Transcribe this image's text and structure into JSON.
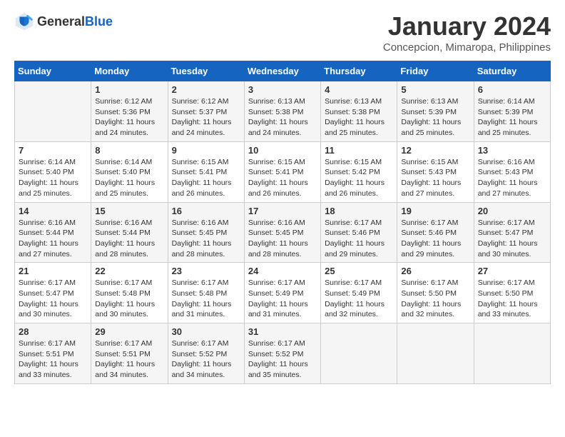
{
  "header": {
    "logo_general": "General",
    "logo_blue": "Blue",
    "month_title": "January 2024",
    "subtitle": "Concepcion, Mimaropa, Philippines"
  },
  "weekdays": [
    "Sunday",
    "Monday",
    "Tuesday",
    "Wednesday",
    "Thursday",
    "Friday",
    "Saturday"
  ],
  "weeks": [
    [
      {
        "day": "",
        "sunrise": "",
        "sunset": "",
        "daylight": ""
      },
      {
        "day": "1",
        "sunrise": "Sunrise: 6:12 AM",
        "sunset": "Sunset: 5:36 PM",
        "daylight": "Daylight: 11 hours and 24 minutes."
      },
      {
        "day": "2",
        "sunrise": "Sunrise: 6:12 AM",
        "sunset": "Sunset: 5:37 PM",
        "daylight": "Daylight: 11 hours and 24 minutes."
      },
      {
        "day": "3",
        "sunrise": "Sunrise: 6:13 AM",
        "sunset": "Sunset: 5:38 PM",
        "daylight": "Daylight: 11 hours and 24 minutes."
      },
      {
        "day": "4",
        "sunrise": "Sunrise: 6:13 AM",
        "sunset": "Sunset: 5:38 PM",
        "daylight": "Daylight: 11 hours and 25 minutes."
      },
      {
        "day": "5",
        "sunrise": "Sunrise: 6:13 AM",
        "sunset": "Sunset: 5:39 PM",
        "daylight": "Daylight: 11 hours and 25 minutes."
      },
      {
        "day": "6",
        "sunrise": "Sunrise: 6:14 AM",
        "sunset": "Sunset: 5:39 PM",
        "daylight": "Daylight: 11 hours and 25 minutes."
      }
    ],
    [
      {
        "day": "7",
        "sunrise": "Sunrise: 6:14 AM",
        "sunset": "Sunset: 5:40 PM",
        "daylight": "Daylight: 11 hours and 25 minutes."
      },
      {
        "day": "8",
        "sunrise": "Sunrise: 6:14 AM",
        "sunset": "Sunset: 5:40 PM",
        "daylight": "Daylight: 11 hours and 25 minutes."
      },
      {
        "day": "9",
        "sunrise": "Sunrise: 6:15 AM",
        "sunset": "Sunset: 5:41 PM",
        "daylight": "Daylight: 11 hours and 26 minutes."
      },
      {
        "day": "10",
        "sunrise": "Sunrise: 6:15 AM",
        "sunset": "Sunset: 5:41 PM",
        "daylight": "Daylight: 11 hours and 26 minutes."
      },
      {
        "day": "11",
        "sunrise": "Sunrise: 6:15 AM",
        "sunset": "Sunset: 5:42 PM",
        "daylight": "Daylight: 11 hours and 26 minutes."
      },
      {
        "day": "12",
        "sunrise": "Sunrise: 6:15 AM",
        "sunset": "Sunset: 5:43 PM",
        "daylight": "Daylight: 11 hours and 27 minutes."
      },
      {
        "day": "13",
        "sunrise": "Sunrise: 6:16 AM",
        "sunset": "Sunset: 5:43 PM",
        "daylight": "Daylight: 11 hours and 27 minutes."
      }
    ],
    [
      {
        "day": "14",
        "sunrise": "Sunrise: 6:16 AM",
        "sunset": "Sunset: 5:44 PM",
        "daylight": "Daylight: 11 hours and 27 minutes."
      },
      {
        "day": "15",
        "sunrise": "Sunrise: 6:16 AM",
        "sunset": "Sunset: 5:44 PM",
        "daylight": "Daylight: 11 hours and 28 minutes."
      },
      {
        "day": "16",
        "sunrise": "Sunrise: 6:16 AM",
        "sunset": "Sunset: 5:45 PM",
        "daylight": "Daylight: 11 hours and 28 minutes."
      },
      {
        "day": "17",
        "sunrise": "Sunrise: 6:16 AM",
        "sunset": "Sunset: 5:45 PM",
        "daylight": "Daylight: 11 hours and 28 minutes."
      },
      {
        "day": "18",
        "sunrise": "Sunrise: 6:17 AM",
        "sunset": "Sunset: 5:46 PM",
        "daylight": "Daylight: 11 hours and 29 minutes."
      },
      {
        "day": "19",
        "sunrise": "Sunrise: 6:17 AM",
        "sunset": "Sunset: 5:46 PM",
        "daylight": "Daylight: 11 hours and 29 minutes."
      },
      {
        "day": "20",
        "sunrise": "Sunrise: 6:17 AM",
        "sunset": "Sunset: 5:47 PM",
        "daylight": "Daylight: 11 hours and 30 minutes."
      }
    ],
    [
      {
        "day": "21",
        "sunrise": "Sunrise: 6:17 AM",
        "sunset": "Sunset: 5:47 PM",
        "daylight": "Daylight: 11 hours and 30 minutes."
      },
      {
        "day": "22",
        "sunrise": "Sunrise: 6:17 AM",
        "sunset": "Sunset: 5:48 PM",
        "daylight": "Daylight: 11 hours and 30 minutes."
      },
      {
        "day": "23",
        "sunrise": "Sunrise: 6:17 AM",
        "sunset": "Sunset: 5:48 PM",
        "daylight": "Daylight: 11 hours and 31 minutes."
      },
      {
        "day": "24",
        "sunrise": "Sunrise: 6:17 AM",
        "sunset": "Sunset: 5:49 PM",
        "daylight": "Daylight: 11 hours and 31 minutes."
      },
      {
        "day": "25",
        "sunrise": "Sunrise: 6:17 AM",
        "sunset": "Sunset: 5:49 PM",
        "daylight": "Daylight: 11 hours and 32 minutes."
      },
      {
        "day": "26",
        "sunrise": "Sunrise: 6:17 AM",
        "sunset": "Sunset: 5:50 PM",
        "daylight": "Daylight: 11 hours and 32 minutes."
      },
      {
        "day": "27",
        "sunrise": "Sunrise: 6:17 AM",
        "sunset": "Sunset: 5:50 PM",
        "daylight": "Daylight: 11 hours and 33 minutes."
      }
    ],
    [
      {
        "day": "28",
        "sunrise": "Sunrise: 6:17 AM",
        "sunset": "Sunset: 5:51 PM",
        "daylight": "Daylight: 11 hours and 33 minutes."
      },
      {
        "day": "29",
        "sunrise": "Sunrise: 6:17 AM",
        "sunset": "Sunset: 5:51 PM",
        "daylight": "Daylight: 11 hours and 34 minutes."
      },
      {
        "day": "30",
        "sunrise": "Sunrise: 6:17 AM",
        "sunset": "Sunset: 5:52 PM",
        "daylight": "Daylight: 11 hours and 34 minutes."
      },
      {
        "day": "31",
        "sunrise": "Sunrise: 6:17 AM",
        "sunset": "Sunset: 5:52 PM",
        "daylight": "Daylight: 11 hours and 35 minutes."
      },
      {
        "day": "",
        "sunrise": "",
        "sunset": "",
        "daylight": ""
      },
      {
        "day": "",
        "sunrise": "",
        "sunset": "",
        "daylight": ""
      },
      {
        "day": "",
        "sunrise": "",
        "sunset": "",
        "daylight": ""
      }
    ]
  ]
}
